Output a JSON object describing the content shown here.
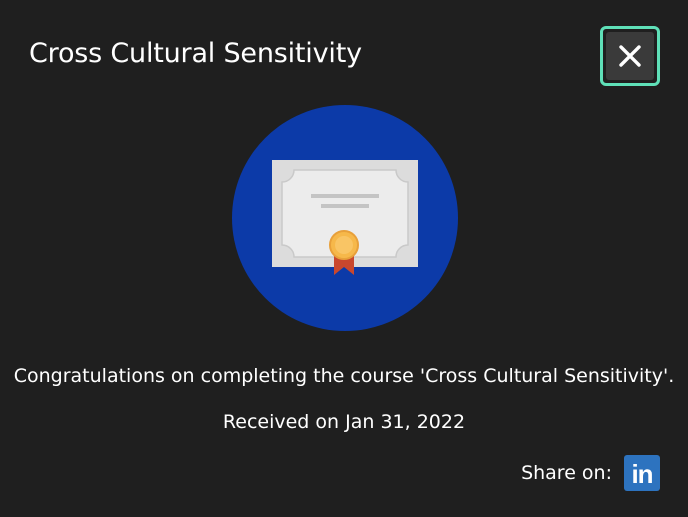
{
  "dialog": {
    "title": "Cross Cultural Sensitivity",
    "message": "Congratulations on completing the course 'Cross Cultural Sensitivity'.",
    "received": "Received on Jan 31, 2022",
    "close_icon": "close-icon",
    "badge_icon": "certificate-icon"
  },
  "share": {
    "label": "Share on:",
    "linkedin_text": "in",
    "linkedin_icon": "linkedin-icon"
  },
  "colors": {
    "background": "#1f1f1f",
    "close_focus_ring": "#5fe0b8",
    "badge_circle": "#0c3aa8",
    "certificate_paper": "#dcdcdc",
    "seal_gold": "#f6b84a",
    "ribbon_red": "#c9472e",
    "linkedin_blue": "#2d73bf"
  }
}
